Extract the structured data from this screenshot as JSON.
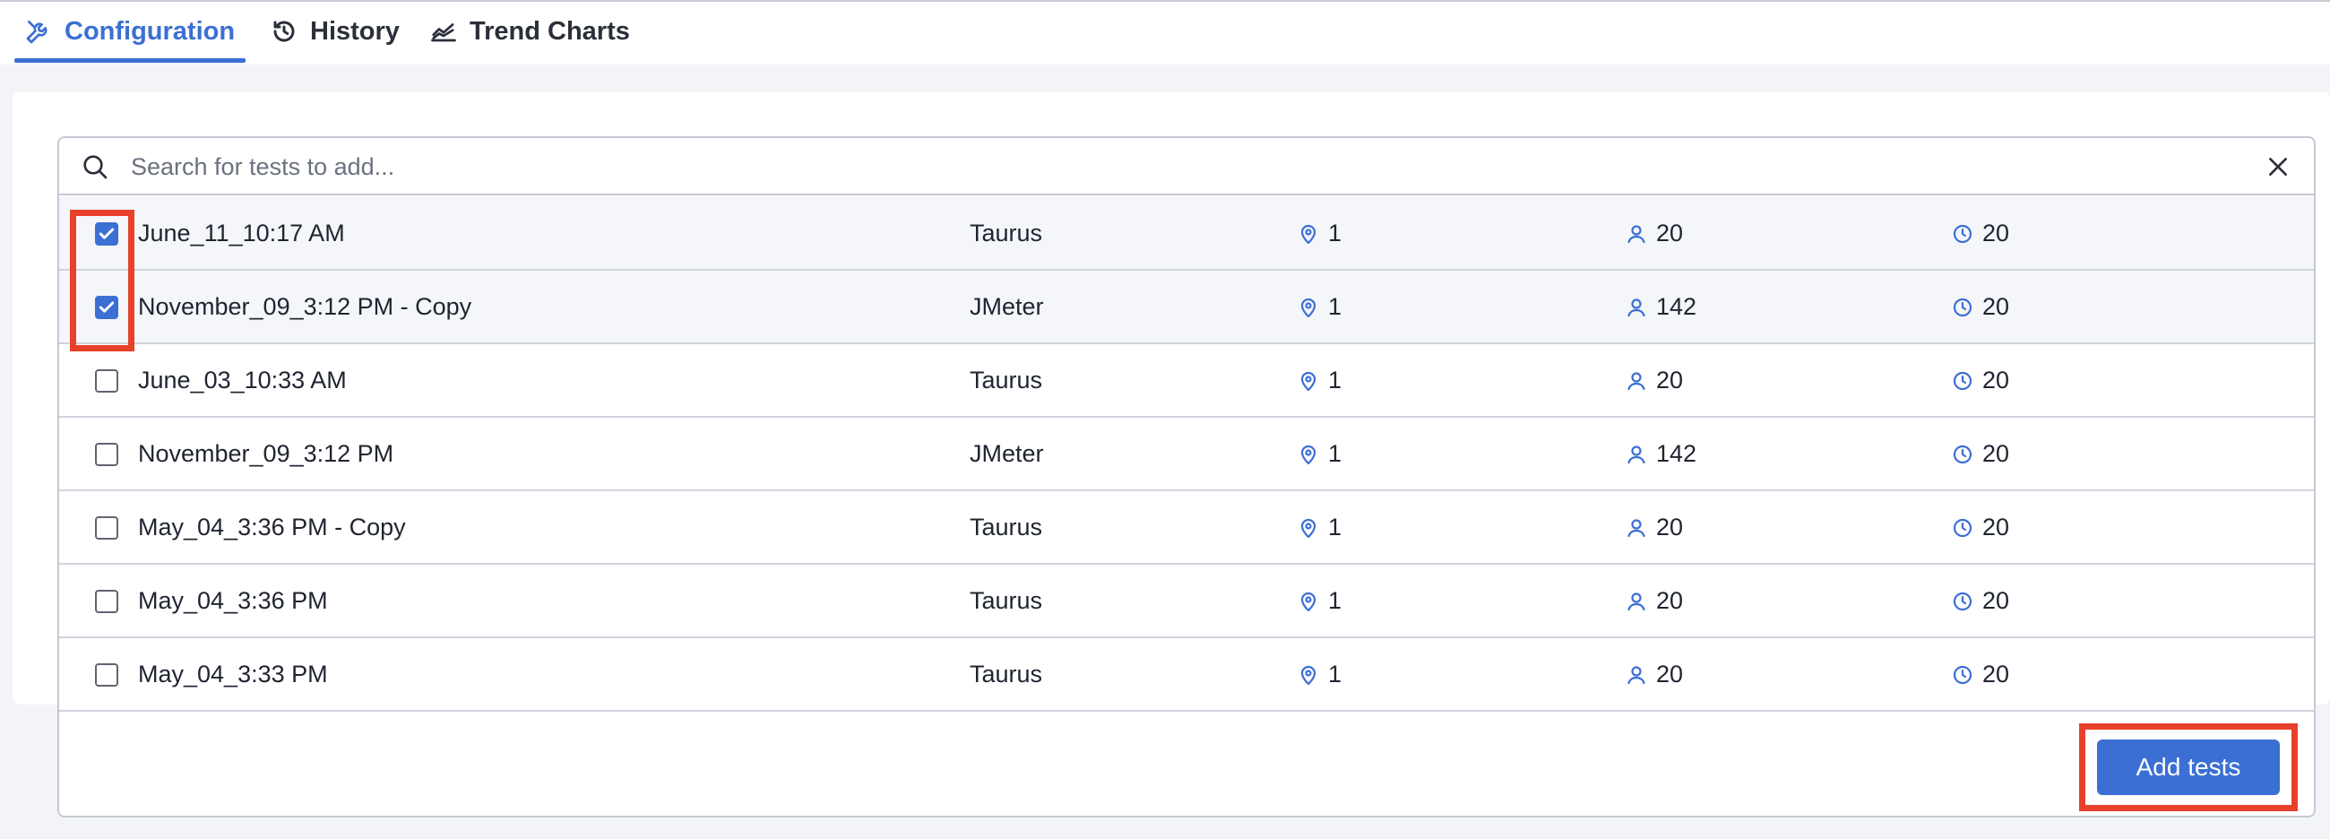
{
  "tabs": [
    {
      "label": "Configuration",
      "icon": "wrench-icon",
      "active": true
    },
    {
      "label": "History",
      "icon": "history-icon",
      "active": false
    },
    {
      "label": "Trend Charts",
      "icon": "trend-chart-icon",
      "active": false
    }
  ],
  "search": {
    "placeholder": "Search for tests to add...",
    "value": ""
  },
  "tests": [
    {
      "name": "June_11_10:17 AM",
      "tool": "Taurus",
      "locations": "1",
      "users": "20",
      "duration": "20",
      "checked": true
    },
    {
      "name": "November_09_3:12 PM - Copy",
      "tool": "JMeter",
      "locations": "1",
      "users": "142",
      "duration": "20",
      "checked": true
    },
    {
      "name": "June_03_10:33 AM",
      "tool": "Taurus",
      "locations": "1",
      "users": "20",
      "duration": "20",
      "checked": false
    },
    {
      "name": "November_09_3:12 PM",
      "tool": "JMeter",
      "locations": "1",
      "users": "142",
      "duration": "20",
      "checked": false
    },
    {
      "name": "May_04_3:36 PM - Copy",
      "tool": "Taurus",
      "locations": "1",
      "users": "20",
      "duration": "20",
      "checked": false
    },
    {
      "name": "May_04_3:36 PM",
      "tool": "Taurus",
      "locations": "1",
      "users": "20",
      "duration": "20",
      "checked": false
    },
    {
      "name": "May_04_3:33 PM",
      "tool": "Taurus",
      "locations": "1",
      "users": "20",
      "duration": "20",
      "checked": false
    }
  ],
  "add_button": {
    "label": "Add tests"
  },
  "colors": {
    "accent": "#3b6fd4",
    "highlight": "#e8402b",
    "icon": "#3b6fd4"
  }
}
